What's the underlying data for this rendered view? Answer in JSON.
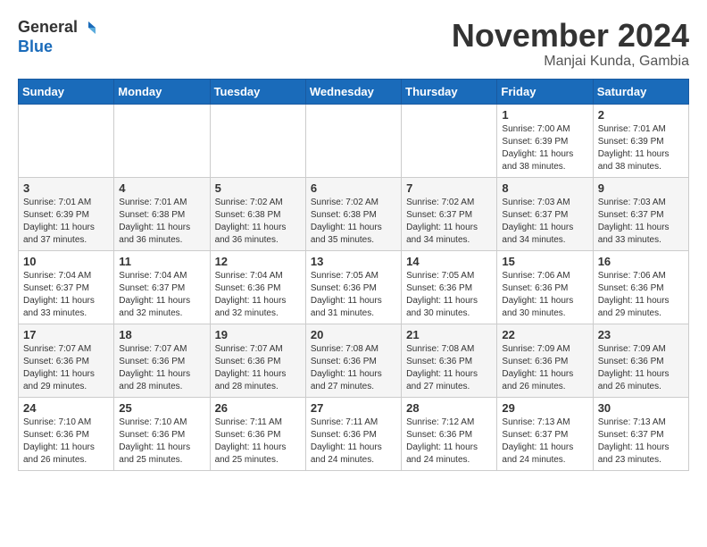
{
  "header": {
    "logo_line1": "General",
    "logo_line2": "Blue",
    "month": "November 2024",
    "location": "Manjai Kunda, Gambia"
  },
  "weekdays": [
    "Sunday",
    "Monday",
    "Tuesday",
    "Wednesday",
    "Thursday",
    "Friday",
    "Saturday"
  ],
  "weeks": [
    [
      {
        "day": "",
        "info": ""
      },
      {
        "day": "",
        "info": ""
      },
      {
        "day": "",
        "info": ""
      },
      {
        "day": "",
        "info": ""
      },
      {
        "day": "",
        "info": ""
      },
      {
        "day": "1",
        "info": "Sunrise: 7:00 AM\nSunset: 6:39 PM\nDaylight: 11 hours\nand 38 minutes."
      },
      {
        "day": "2",
        "info": "Sunrise: 7:01 AM\nSunset: 6:39 PM\nDaylight: 11 hours\nand 38 minutes."
      }
    ],
    [
      {
        "day": "3",
        "info": "Sunrise: 7:01 AM\nSunset: 6:39 PM\nDaylight: 11 hours\nand 37 minutes."
      },
      {
        "day": "4",
        "info": "Sunrise: 7:01 AM\nSunset: 6:38 PM\nDaylight: 11 hours\nand 36 minutes."
      },
      {
        "day": "5",
        "info": "Sunrise: 7:02 AM\nSunset: 6:38 PM\nDaylight: 11 hours\nand 36 minutes."
      },
      {
        "day": "6",
        "info": "Sunrise: 7:02 AM\nSunset: 6:38 PM\nDaylight: 11 hours\nand 35 minutes."
      },
      {
        "day": "7",
        "info": "Sunrise: 7:02 AM\nSunset: 6:37 PM\nDaylight: 11 hours\nand 34 minutes."
      },
      {
        "day": "8",
        "info": "Sunrise: 7:03 AM\nSunset: 6:37 PM\nDaylight: 11 hours\nand 34 minutes."
      },
      {
        "day": "9",
        "info": "Sunrise: 7:03 AM\nSunset: 6:37 PM\nDaylight: 11 hours\nand 33 minutes."
      }
    ],
    [
      {
        "day": "10",
        "info": "Sunrise: 7:04 AM\nSunset: 6:37 PM\nDaylight: 11 hours\nand 33 minutes."
      },
      {
        "day": "11",
        "info": "Sunrise: 7:04 AM\nSunset: 6:37 PM\nDaylight: 11 hours\nand 32 minutes."
      },
      {
        "day": "12",
        "info": "Sunrise: 7:04 AM\nSunset: 6:36 PM\nDaylight: 11 hours\nand 32 minutes."
      },
      {
        "day": "13",
        "info": "Sunrise: 7:05 AM\nSunset: 6:36 PM\nDaylight: 11 hours\nand 31 minutes."
      },
      {
        "day": "14",
        "info": "Sunrise: 7:05 AM\nSunset: 6:36 PM\nDaylight: 11 hours\nand 30 minutes."
      },
      {
        "day": "15",
        "info": "Sunrise: 7:06 AM\nSunset: 6:36 PM\nDaylight: 11 hours\nand 30 minutes."
      },
      {
        "day": "16",
        "info": "Sunrise: 7:06 AM\nSunset: 6:36 PM\nDaylight: 11 hours\nand 29 minutes."
      }
    ],
    [
      {
        "day": "17",
        "info": "Sunrise: 7:07 AM\nSunset: 6:36 PM\nDaylight: 11 hours\nand 29 minutes."
      },
      {
        "day": "18",
        "info": "Sunrise: 7:07 AM\nSunset: 6:36 PM\nDaylight: 11 hours\nand 28 minutes."
      },
      {
        "day": "19",
        "info": "Sunrise: 7:07 AM\nSunset: 6:36 PM\nDaylight: 11 hours\nand 28 minutes."
      },
      {
        "day": "20",
        "info": "Sunrise: 7:08 AM\nSunset: 6:36 PM\nDaylight: 11 hours\nand 27 minutes."
      },
      {
        "day": "21",
        "info": "Sunrise: 7:08 AM\nSunset: 6:36 PM\nDaylight: 11 hours\nand 27 minutes."
      },
      {
        "day": "22",
        "info": "Sunrise: 7:09 AM\nSunset: 6:36 PM\nDaylight: 11 hours\nand 26 minutes."
      },
      {
        "day": "23",
        "info": "Sunrise: 7:09 AM\nSunset: 6:36 PM\nDaylight: 11 hours\nand 26 minutes."
      }
    ],
    [
      {
        "day": "24",
        "info": "Sunrise: 7:10 AM\nSunset: 6:36 PM\nDaylight: 11 hours\nand 26 minutes."
      },
      {
        "day": "25",
        "info": "Sunrise: 7:10 AM\nSunset: 6:36 PM\nDaylight: 11 hours\nand 25 minutes."
      },
      {
        "day": "26",
        "info": "Sunrise: 7:11 AM\nSunset: 6:36 PM\nDaylight: 11 hours\nand 25 minutes."
      },
      {
        "day": "27",
        "info": "Sunrise: 7:11 AM\nSunset: 6:36 PM\nDaylight: 11 hours\nand 24 minutes."
      },
      {
        "day": "28",
        "info": "Sunrise: 7:12 AM\nSunset: 6:36 PM\nDaylight: 11 hours\nand 24 minutes."
      },
      {
        "day": "29",
        "info": "Sunrise: 7:13 AM\nSunset: 6:37 PM\nDaylight: 11 hours\nand 24 minutes."
      },
      {
        "day": "30",
        "info": "Sunrise: 7:13 AM\nSunset: 6:37 PM\nDaylight: 11 hours\nand 23 minutes."
      }
    ]
  ]
}
